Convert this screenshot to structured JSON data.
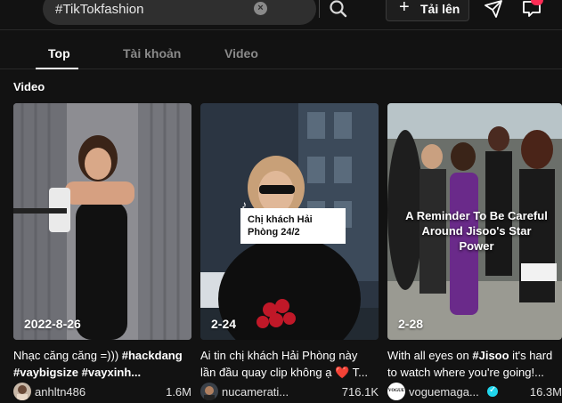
{
  "header": {
    "search_query": "#TikTokfashion",
    "upload_label": "Tải lên"
  },
  "tabs": [
    {
      "label": "Top"
    },
    {
      "label": "Tài khoản"
    },
    {
      "label": "Video"
    }
  ],
  "section_title": "Video",
  "videos": [
    {
      "date": "2022-8-26",
      "caption_plain": "Nhạc căng căng =))) ",
      "caption_tag1": "#hackdang",
      "caption_tag2": "#vaybigsize",
      "caption_tag3": " #vayxinh...",
      "author": "anhltn486",
      "views": "1.6M"
    },
    {
      "date": "2-24",
      "overlay": "Chị khách Hải Phòng 24/2",
      "caption_line1": "Ai tin chị khách Hải Phòng này",
      "caption_line2": "lần đầu quay clip không ạ",
      "caption_heart": "❤️",
      "caption_end": " T...",
      "author": "nucamerati...",
      "views": "716.1K"
    },
    {
      "date": "2-28",
      "overlay": "A Reminder To Be Careful Around Jisoo's Star Power",
      "caption_pre": "With all eyes on ",
      "caption_tag": "#Jisoo",
      "caption_post": " it's hard",
      "caption_line2": "to watch where you're going!...",
      "author": "voguemaga...",
      "views": "16.3M",
      "avatar_text": "VOGUE"
    }
  ],
  "colors": {
    "background": "#121212",
    "accent": "#fe2c55",
    "verified": "#20d5ec"
  }
}
